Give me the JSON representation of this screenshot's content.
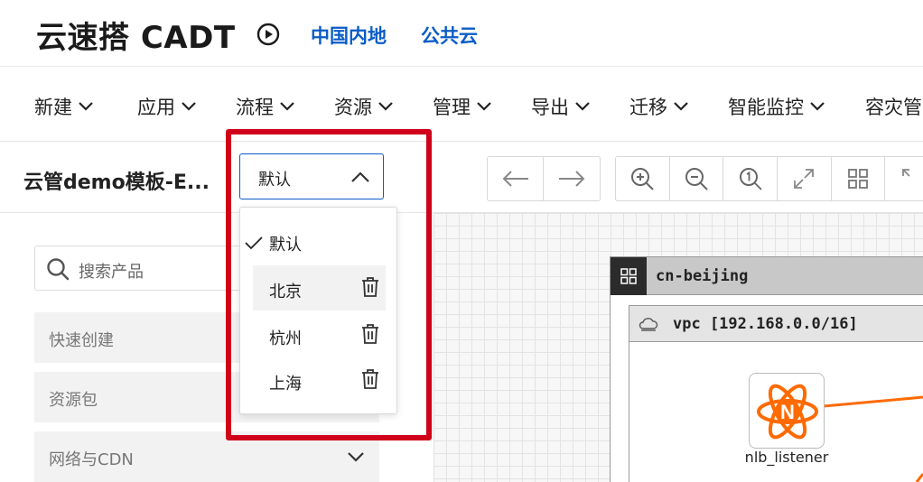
{
  "header": {
    "app_title": "云速搭 CADT",
    "region_links": [
      "中国内地",
      "公共云"
    ]
  },
  "menubar": {
    "items": [
      {
        "label": "新建"
      },
      {
        "label": "应用"
      },
      {
        "label": "流程"
      },
      {
        "label": "资源"
      },
      {
        "label": "管理"
      },
      {
        "label": "导出"
      },
      {
        "label": "迁移"
      },
      {
        "label": "智能监控"
      },
      {
        "label": "容灾管"
      }
    ]
  },
  "left_panel": {
    "template_title": "云管demo模板-E...",
    "search_placeholder": "搜索产品",
    "categories": [
      "快速创建",
      "资源包",
      "网络与CDN"
    ]
  },
  "selector": {
    "selected": "默认",
    "options": [
      "默认",
      "北京",
      "杭州",
      "上海"
    ]
  },
  "canvas": {
    "region_label": "cn-beijing",
    "vpc_label": "vpc [192.168.0.0/16]",
    "node_label": "nlb_listener",
    "node_color": "#ff6a00",
    "highlight_color": "#d0021b"
  }
}
